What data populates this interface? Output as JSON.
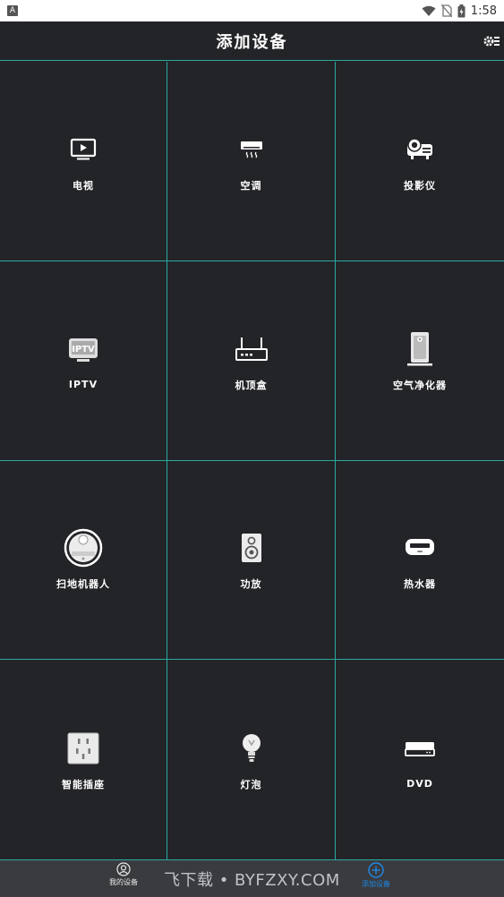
{
  "status_bar": {
    "app_badge": "A",
    "time": "1:58"
  },
  "header": {
    "title": "添加设备"
  },
  "devices": [
    {
      "label": "电视",
      "icon": "tv-icon"
    },
    {
      "label": "空调",
      "icon": "air-conditioner-icon"
    },
    {
      "label": "投影仪",
      "icon": "projector-icon"
    },
    {
      "label": "IPTV",
      "icon": "iptv-icon"
    },
    {
      "label": "机顶盒",
      "icon": "set-top-box-icon"
    },
    {
      "label": "空气净化器",
      "icon": "air-purifier-icon"
    },
    {
      "label": "扫地机器人",
      "icon": "robot-vacuum-icon"
    },
    {
      "label": "功放",
      "icon": "amplifier-icon"
    },
    {
      "label": "热水器",
      "icon": "water-heater-icon"
    },
    {
      "label": "智能插座",
      "icon": "smart-socket-icon"
    },
    {
      "label": "灯泡",
      "icon": "light-bulb-icon"
    },
    {
      "label": "DVD",
      "icon": "dvd-icon"
    }
  ],
  "bottom_nav": {
    "mine_label": "我的设备",
    "add_label": "添加设备",
    "watermark": "飞下载 • BYFZXY.COM"
  },
  "colors": {
    "background": "#232427",
    "grid_line": "#2aa9a0",
    "active_tab": "#1e88e5"
  }
}
